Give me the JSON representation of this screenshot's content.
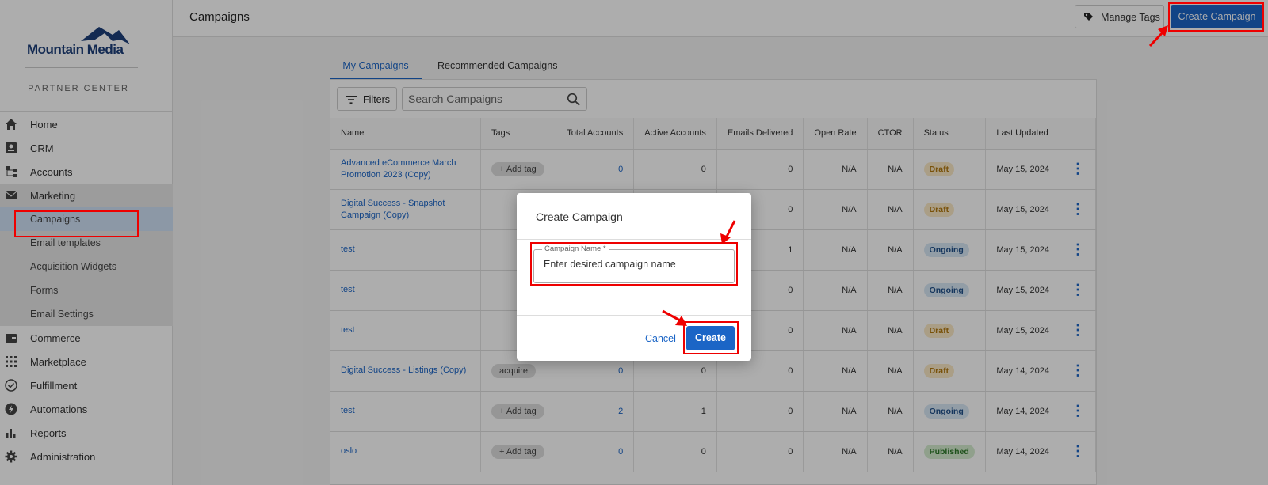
{
  "brand": {
    "name": "Mountain Media",
    "subtitle": "PARTNER CENTER"
  },
  "nav": {
    "home": "Home",
    "crm": "CRM",
    "accounts": "Accounts",
    "marketing": "Marketing",
    "campaigns": "Campaigns",
    "email_templates": "Email templates",
    "acquisition_widgets": "Acquisition Widgets",
    "forms": "Forms",
    "email_settings": "Email Settings",
    "commerce": "Commerce",
    "marketplace": "Marketplace",
    "fulfillment": "Fulfillment",
    "automations": "Automations",
    "reports": "Reports",
    "administration": "Administration"
  },
  "header": {
    "title": "Campaigns",
    "manage_tags": "Manage Tags",
    "create_campaign": "Create Campaign"
  },
  "tabs": {
    "my": "My Campaigns",
    "recommended": "Recommended Campaigns"
  },
  "toolbar": {
    "filters": "Filters",
    "search_placeholder": "Search Campaigns"
  },
  "table": {
    "columns": [
      "Name",
      "Tags",
      "Total Accounts",
      "Active Accounts",
      "Emails Delivered",
      "Open Rate",
      "CTOR",
      "Status",
      "Last Updated"
    ],
    "rows": [
      {
        "name": "Advanced eCommerce March Promotion 2023 (Copy)",
        "tag": "+ Add tag",
        "total": "0",
        "active": "0",
        "emails": "0",
        "open": "N/A",
        "ctor": "N/A",
        "status": "Draft",
        "updated": "May 15, 2024"
      },
      {
        "name": "Digital Success - Snapshot Campaign (Copy)",
        "tag": "",
        "total": "",
        "active": "",
        "emails": "0",
        "open": "N/A",
        "ctor": "N/A",
        "status": "Draft",
        "updated": "May 15, 2024"
      },
      {
        "name": "test",
        "tag": "",
        "total": "",
        "active": "",
        "emails": "1",
        "open": "N/A",
        "ctor": "N/A",
        "status": "Ongoing",
        "updated": "May 15, 2024"
      },
      {
        "name": "test",
        "tag": "",
        "total": "",
        "active": "",
        "emails": "0",
        "open": "N/A",
        "ctor": "N/A",
        "status": "Ongoing",
        "updated": "May 15, 2024"
      },
      {
        "name": "test",
        "tag": "",
        "total": "",
        "active": "",
        "emails": "0",
        "open": "N/A",
        "ctor": "N/A",
        "status": "Draft",
        "updated": "May 15, 2024"
      },
      {
        "name": "Digital Success - Listings (Copy)",
        "tag": "acquire",
        "total": "0",
        "active": "0",
        "emails": "0",
        "open": "N/A",
        "ctor": "N/A",
        "status": "Draft",
        "updated": "May 14, 2024"
      },
      {
        "name": "test",
        "tag": "+ Add tag",
        "total": "2",
        "active": "1",
        "emails": "0",
        "open": "N/A",
        "ctor": "N/A",
        "status": "Ongoing",
        "updated": "May 14, 2024"
      },
      {
        "name": "oslo",
        "tag": "+ Add tag",
        "total": "0",
        "active": "0",
        "emails": "0",
        "open": "N/A",
        "ctor": "N/A",
        "status": "Published",
        "updated": "May 14, 2024"
      }
    ]
  },
  "modal": {
    "title": "Create Campaign",
    "field_label": "Campaign Name *",
    "field_placeholder": "Enter desired campaign name",
    "cancel": "Cancel",
    "create": "Create"
  },
  "colors": {
    "accent": "#1b65c6",
    "highlight": "#e00000"
  }
}
